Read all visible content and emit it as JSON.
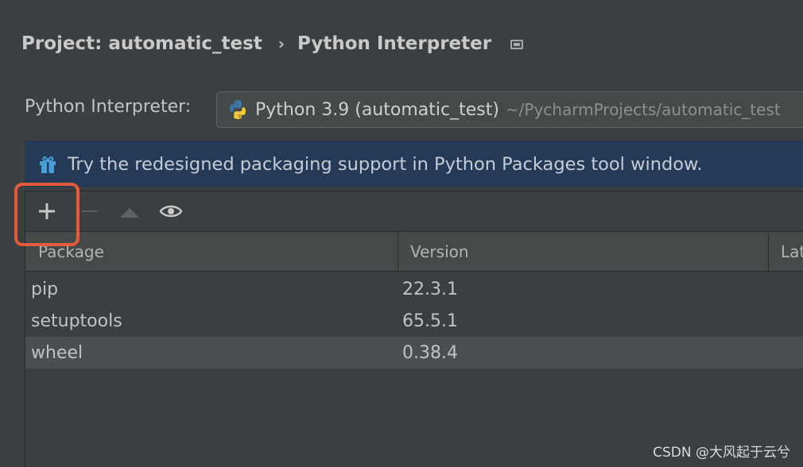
{
  "breadcrumb": {
    "project": "Project: automatic_test",
    "separator": "›",
    "current": "Python Interpreter"
  },
  "interpreter": {
    "label": "Python Interpreter:",
    "name": "Python 3.9 (automatic_test)",
    "path": "~/PycharmProjects/automatic_test"
  },
  "banner": {
    "text": "Try the redesigned packaging support in Python Packages tool window."
  },
  "toolbar": {
    "add_label": "+",
    "remove_label": "−",
    "icons": [
      "plus-icon",
      "minus-icon",
      "upgrade-icon",
      "eye-icon"
    ]
  },
  "table": {
    "columns": [
      "Package",
      "Version",
      "Latest version"
    ],
    "rows": [
      {
        "package": "pip",
        "version": "22.3.1",
        "latest": ""
      },
      {
        "package": "setuptools",
        "version": "65.5.1",
        "latest": ""
      },
      {
        "package": "wheel",
        "version": "0.38.4",
        "latest": ""
      }
    ]
  },
  "watermark": "CSDN @大风起于云兮",
  "colors": {
    "background": "#3c3f41",
    "banner": "#243a57",
    "highlight": "#e35a3c",
    "selected_row": "#4b4f51"
  }
}
